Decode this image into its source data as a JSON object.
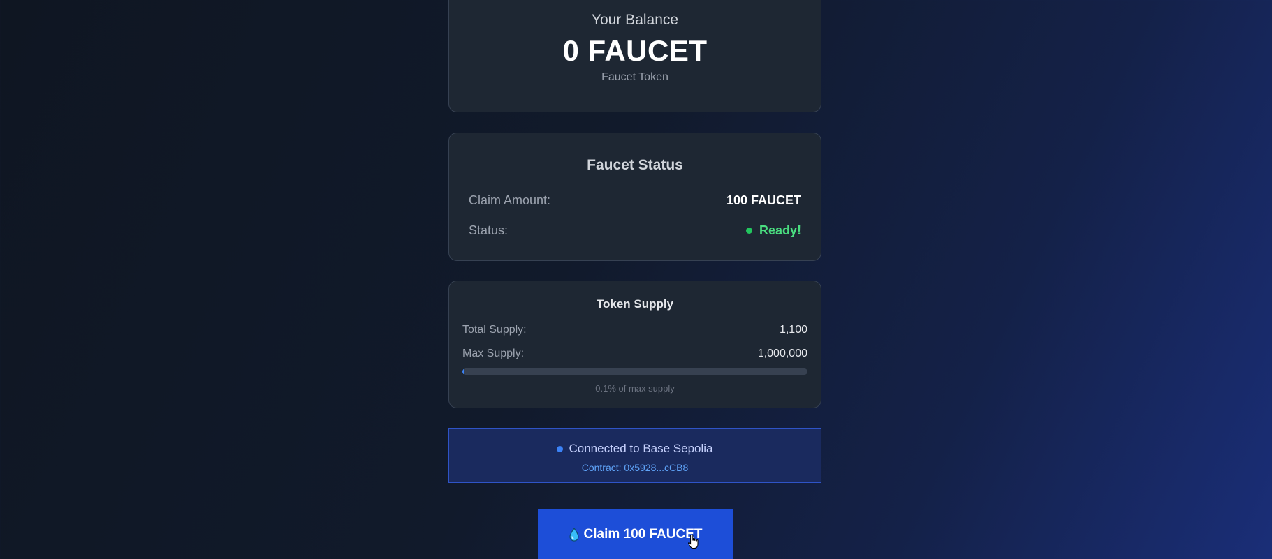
{
  "balance": {
    "title": "Your Balance",
    "amount": "0 FAUCET",
    "token_name": "Faucet Token"
  },
  "faucet_status": {
    "title": "Faucet Status",
    "claim_label": "Claim Amount:",
    "claim_value": "100 FAUCET",
    "status_label": "Status:",
    "status_value": "Ready!",
    "status_color": "#4ade80"
  },
  "supply": {
    "title": "Token Supply",
    "total_label": "Total Supply:",
    "total_value": "1,100",
    "max_label": "Max Supply:",
    "max_value": "1,000,000",
    "progress_percent": 0.11,
    "note": "0.1% of max supply"
  },
  "network": {
    "connection_text": "Connected to Base Sepolia",
    "contract_text": "Contract: 0x5928...cCB8"
  },
  "claim_button": {
    "label": "Claim 100 FAUCET",
    "icon": "droplet-icon"
  },
  "colors": {
    "accent": "#1d4ed8",
    "ready": "#22c55e",
    "network_dot": "#3b82f6"
  }
}
